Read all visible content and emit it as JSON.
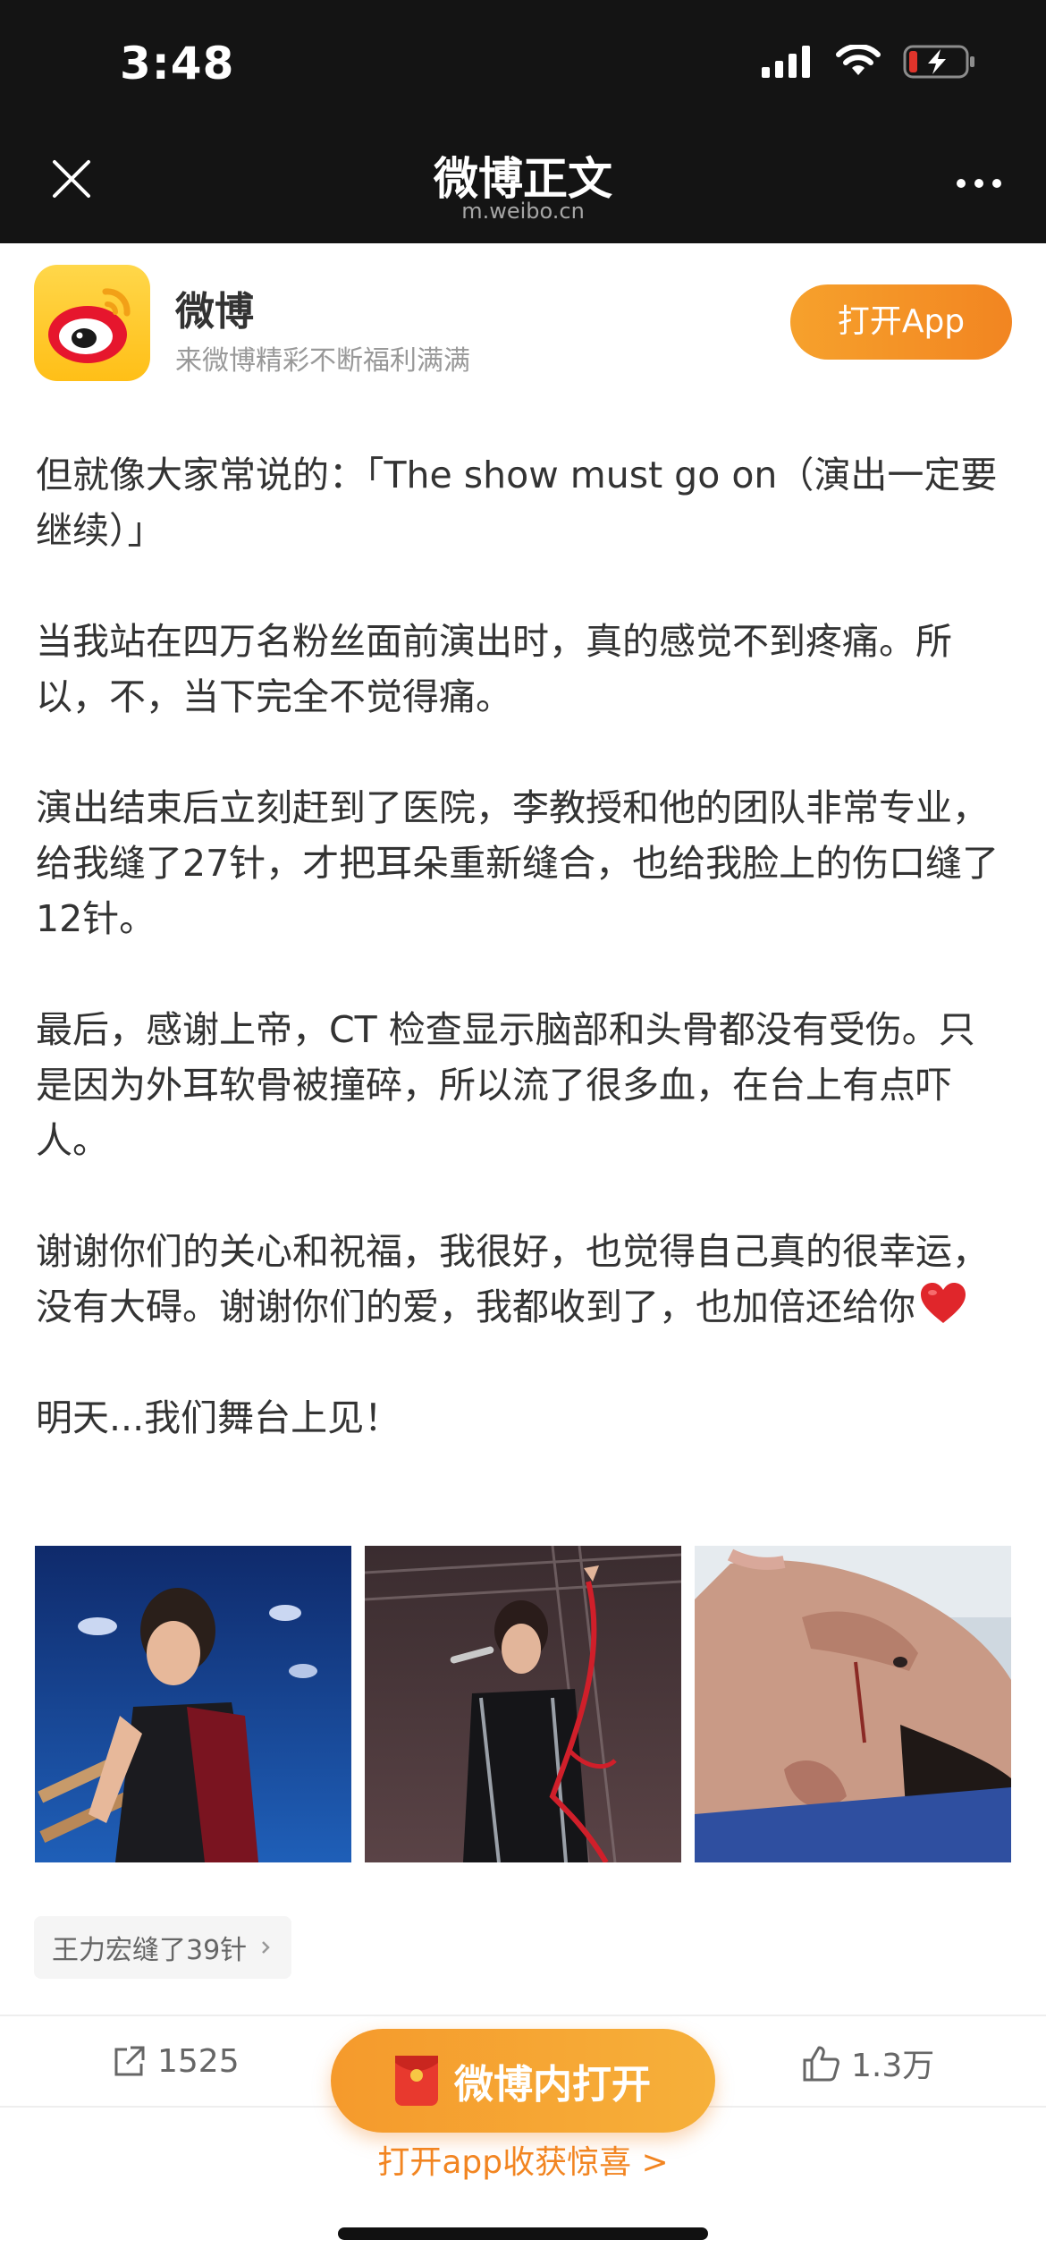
{
  "status_bar": {
    "time": "3:48"
  },
  "nav": {
    "title": "微博正文",
    "subtitle": "m.weibo.cn",
    "close_icon": "close-icon",
    "more_icon": "more-icon"
  },
  "promo": {
    "app_name": "微博",
    "tagline": "来微博精彩不断福利满满",
    "open_button": "打开App"
  },
  "post": {
    "paragraphs": [
      "但就像大家常说的：「The show must go on（演出一定要继续）」",
      "当我站在四万名粉丝面前演出时，真的感觉不到疼痛。所以，不，当下完全不觉得痛。",
      "演出结束后立刻赶到了医院，李教授和他的团队非常专业，给我缝了27针，才把耳朵重新缝合，也给我脸上的伤口缝了12针。",
      "最后，感谢上帝，CT 检查显示脑部和头骨都没有受伤。只是因为外耳软骨被撞碎，所以流了很多血，在台上有点吓人。",
      "谢谢你们的关心和祝福，我很好，也觉得自己真的很幸运，没有大碍。谢谢你们的爱，我都收到了，也加倍还给你",
      "明天...我们舞台上见！"
    ],
    "emoji": "heart-icon",
    "images": 3
  },
  "topic": {
    "label": "王力宏缝了39针"
  },
  "actions": {
    "share_count": "1525",
    "like_count": "1.3万",
    "float_button": "微博内打开",
    "bottom_link": "打开app收获惊喜 >"
  },
  "colors": {
    "accent": "#f28521",
    "topbar": "#141414",
    "logo_yellow": "#ffc21a",
    "logo_red": "#e6162d"
  }
}
